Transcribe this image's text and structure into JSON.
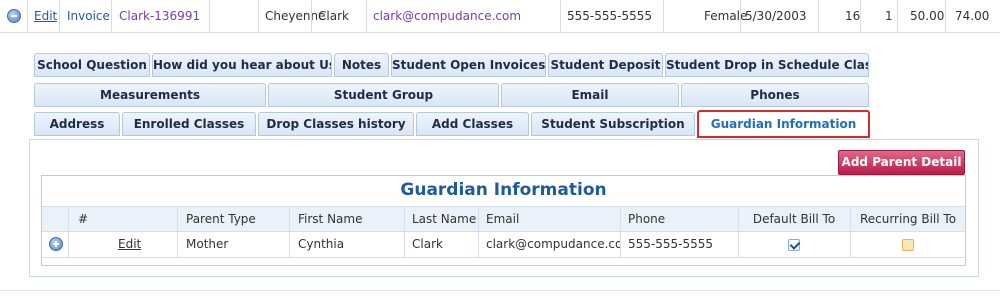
{
  "record": {
    "edit_label": "Edit",
    "invoice_label": "Invoice",
    "student_id": "Clark-136991",
    "first_name": "Cheyenne",
    "last_name": "Clark",
    "email": "clark@compudance.com",
    "phone": "555-555-5555",
    "gender": "Female",
    "dob": "5/30/2003",
    "age": "16",
    "count": "1",
    "amount1": "50.00",
    "amount2": "74.00"
  },
  "tabs": {
    "row1": [
      "School Question",
      "How did you hear about Us",
      "Notes",
      "Student Open Invoices",
      "Student Deposit",
      "Student Drop in Schedule Class"
    ],
    "row2": [
      "Measurements",
      "Student Group",
      "Email",
      "Phones"
    ],
    "row3": [
      "Address",
      "Enrolled Classes",
      "Drop Classes history",
      "Add Classes",
      "Student Subscription",
      "Guardian Information"
    ],
    "active": "Guardian Information"
  },
  "panel": {
    "add_button": "Add Parent Detail",
    "grid_title": "Guardian Information",
    "columns": [
      "#",
      "Parent Type",
      "First Name",
      "Last Name",
      "Email",
      "Phone",
      "Default Bill To",
      "Recurring Bill To"
    ],
    "rows": [
      {
        "edit": "Edit",
        "parent_type": "Mother",
        "first_name": "Cynthia",
        "last_name": "Clark",
        "email": "clark@compudance.com",
        "phone": "555-555-5555",
        "default_bill_to": true,
        "recurring_bill_to": false
      }
    ]
  },
  "colors": {
    "accent": "#1d5a9e",
    "active_tab_border": "#d62b2b",
    "add_button": "#c62a56"
  },
  "icons": {
    "collapse": "minus-circle-icon",
    "expand": "plus-circle-icon",
    "check": "checkmark-icon"
  }
}
